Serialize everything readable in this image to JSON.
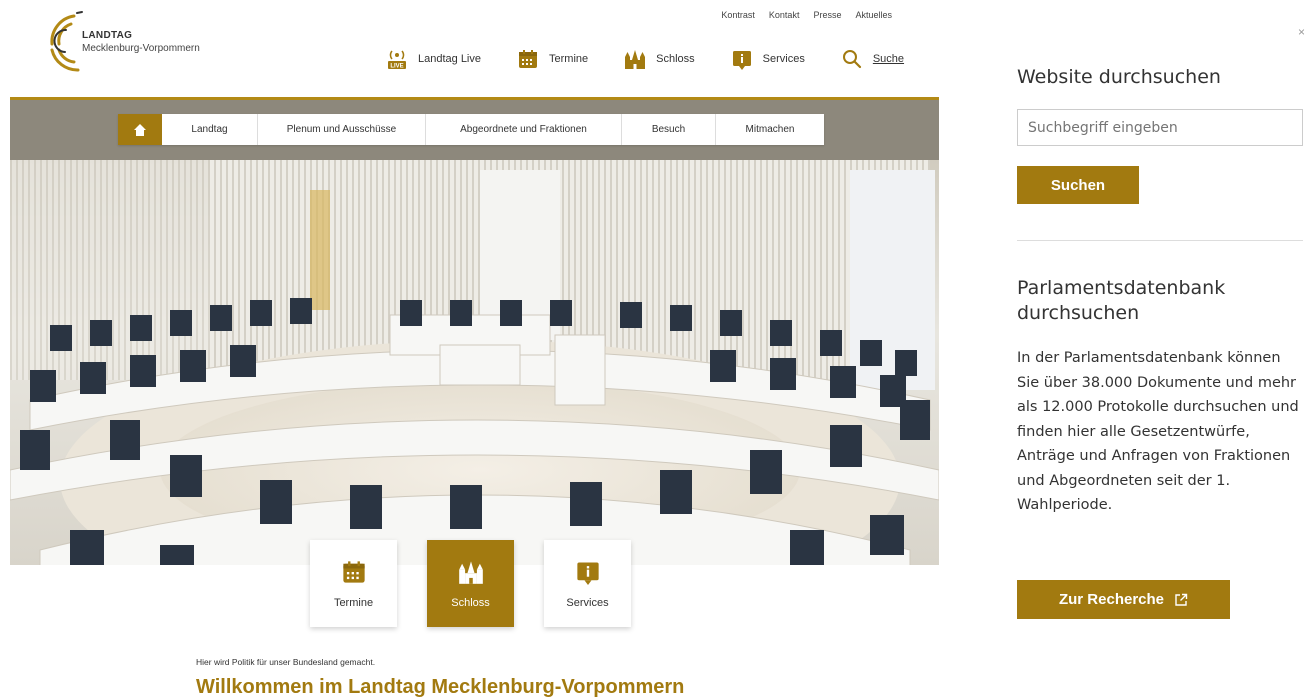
{
  "colors": {
    "accent": "#a27a10",
    "text": "#333333"
  },
  "logo": {
    "title": "LANDTAG",
    "subtitle": "Mecklenburg-Vorpommern"
  },
  "top_links": [
    "Kontrast",
    "Kontakt",
    "Presse",
    "Aktuelles"
  ],
  "main_nav": [
    {
      "label": "Landtag Live",
      "icon": "live-icon"
    },
    {
      "label": "Termine",
      "icon": "calendar-icon"
    },
    {
      "label": "Schloss",
      "icon": "castle-icon"
    },
    {
      "label": "Services",
      "icon": "info-icon"
    },
    {
      "label": "Suche",
      "icon": "search-icon"
    }
  ],
  "sub_nav": {
    "home_icon": "home-icon",
    "items": [
      "Landtag",
      "Plenum und Ausschüsse",
      "Abgeordnete und Fraktionen",
      "Besuch",
      "Mitmachen"
    ]
  },
  "tiles": [
    {
      "label": "Termine",
      "icon": "calendar-icon",
      "active": false
    },
    {
      "label": "Schloss",
      "icon": "castle-icon",
      "active": true
    },
    {
      "label": "Services",
      "icon": "info-icon",
      "active": false
    }
  ],
  "intro": {
    "small": "Hier wird Politik für unser Bundesland gemacht.",
    "title": "Willkommen im Landtag Mecklenburg-Vorpommern"
  },
  "panel": {
    "close": "×",
    "search_heading": "Website durchsuchen",
    "search_placeholder": "Suchbegriff eingeben",
    "search_button": "Suchen",
    "db_heading": "Parlamentsdatenbank durchsuchen",
    "db_text": "In der Parlamentsdatenbank können Sie über 38.000 Dokumente und mehr als 12.000 Protokolle durchsuchen und finden hier alle Gesetzentwürfe, Anträge und Anfragen von Fraktionen und Abgeordneten seit der 1. Wahlperiode.",
    "db_button": "Zur Recherche",
    "db_button_icon": "external-link-icon"
  }
}
